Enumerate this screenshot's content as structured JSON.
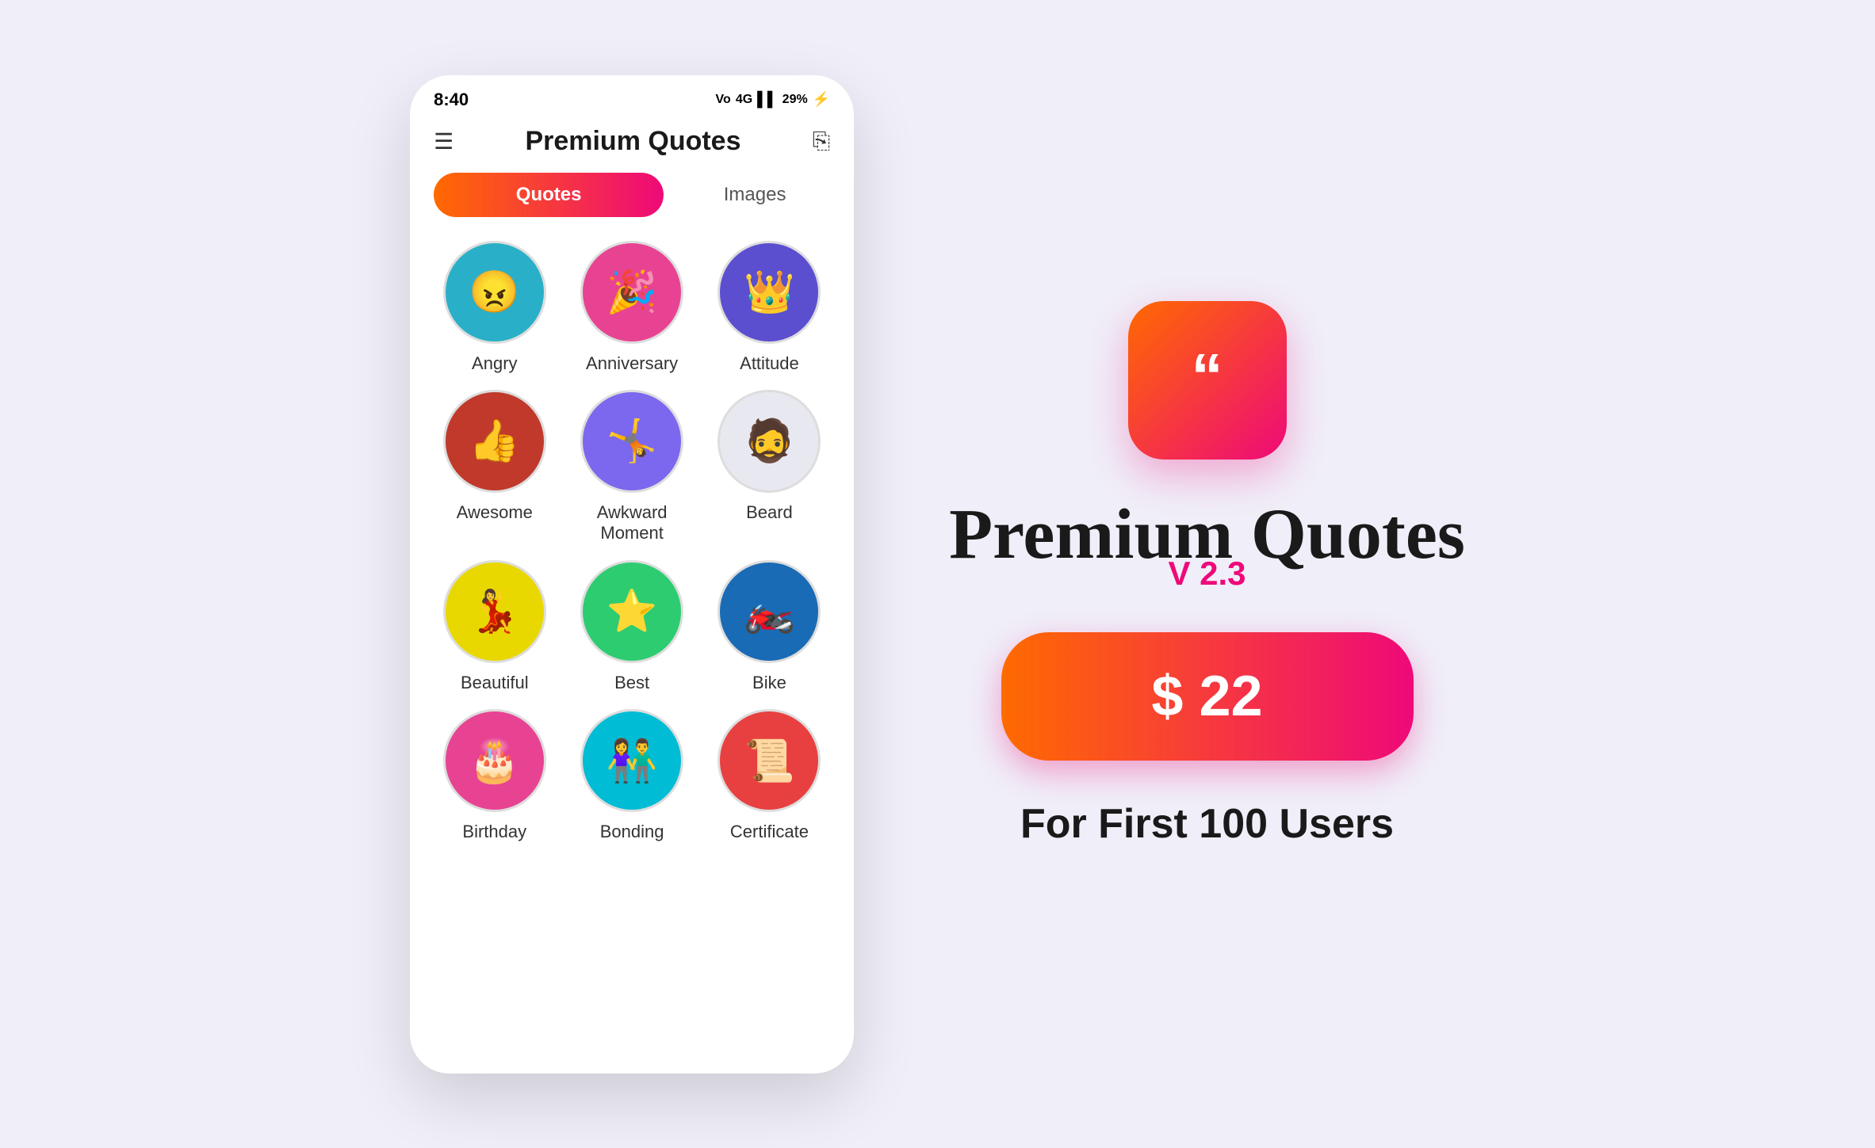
{
  "app": {
    "title": "Premium Quotes",
    "version": "V 2.3",
    "price": "$ 22",
    "for_users": "For First 100 Users",
    "icon_char": "““"
  },
  "phone": {
    "status_time": "8:40",
    "status_right": "Vo 4G 29% ⚡",
    "header_title": "Premium Quotes",
    "tab_quotes": "Quotes",
    "tab_images": "Images"
  },
  "categories": [
    {
      "label": "Angry",
      "emoji": "😠",
      "color_class": "circle-angry"
    },
    {
      "label": "Anniversary",
      "emoji": "🎉",
      "color_class": "circle-anniversary"
    },
    {
      "label": "Attitude",
      "emoji": "👑",
      "color_class": "circle-attitude"
    },
    {
      "label": "Awesome",
      "emoji": "👍",
      "color_class": "circle-awesome"
    },
    {
      "label": "Awkward\nMoment",
      "emoji": "🤸",
      "color_class": "circle-awkward"
    },
    {
      "label": "Beard",
      "emoji": "🧔",
      "color_class": "circle-beard"
    },
    {
      "label": "Beautiful",
      "emoji": "💃",
      "color_class": "circle-beautiful"
    },
    {
      "label": "Best",
      "emoji": "⭐",
      "color_class": "circle-best"
    },
    {
      "label": "Bike",
      "emoji": "🏍️",
      "color_class": "circle-bike"
    },
    {
      "label": "Birthday",
      "emoji": "🎂",
      "color_class": "circle-birthday"
    },
    {
      "label": "Bonding",
      "emoji": "👫",
      "color_class": "circle-bonding"
    },
    {
      "label": "Certificate",
      "emoji": "📜",
      "color_class": "circle-certificate"
    }
  ]
}
